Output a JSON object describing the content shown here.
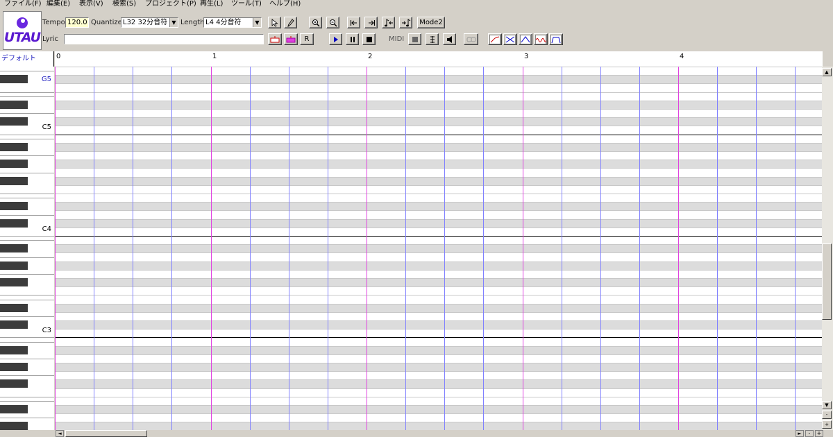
{
  "menu": [
    "ファイル(F)",
    "編集(E)",
    "表示(V)",
    "検索(S)",
    "プロジェクト(P)",
    "再生(L)",
    "ツール(T)",
    "ヘルプ(H)"
  ],
  "logo_text": "UTAU",
  "toolbar": {
    "tempo_label": "Tempo",
    "tempo_value": "120.0",
    "quantize_label": "Quantize",
    "quantize_value": "L32 32分音符",
    "length_label": "Length",
    "length_value": "L4  4分音符",
    "lyric_label": "Lyric",
    "lyric_value": "",
    "mode_button": "Mode2",
    "midi_label": "MIDI",
    "r_button": "R"
  },
  "track_label": "デフォルト",
  "ruler": {
    "bars": [
      "0",
      "1",
      "2",
      "3",
      "4"
    ]
  },
  "octave_labels": [
    "G5",
    "C5",
    "C4",
    "C3"
  ],
  "colors": {
    "bar_line": "#e040e0",
    "beat_line": "#8080ff",
    "black_row": "#dcdcdc",
    "white_row": "#ffffff"
  },
  "icons": {
    "arrow_tool": "pointer-icon",
    "pencil_tool": "pencil-icon",
    "zoom_in": "zoom-in-icon",
    "zoom_out": "zoom-out-icon",
    "play": "play-icon",
    "pause": "pause-icon",
    "stop": "stop-icon",
    "speaker": "speaker-icon"
  }
}
